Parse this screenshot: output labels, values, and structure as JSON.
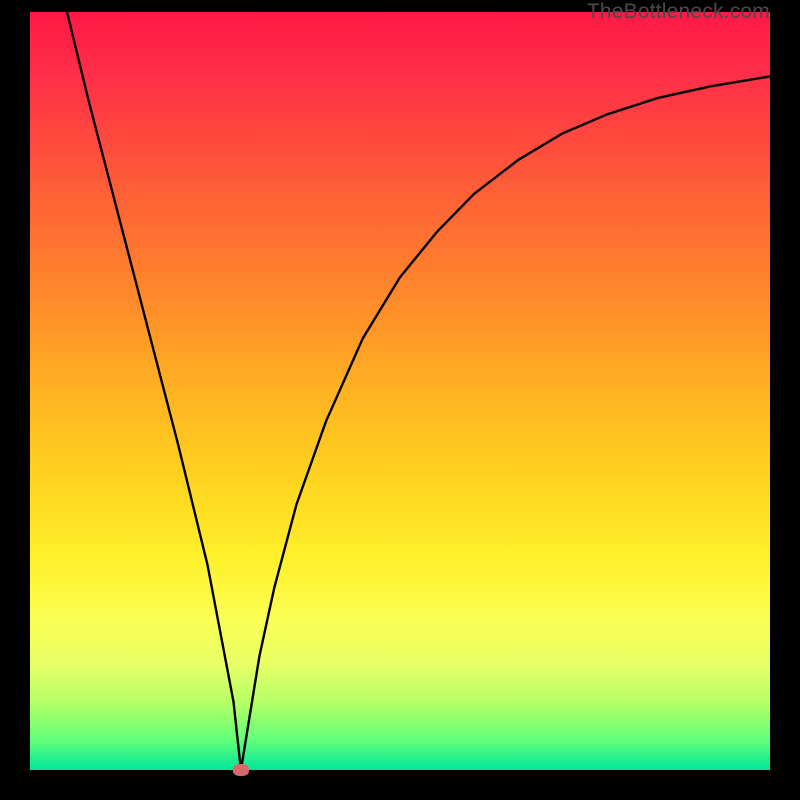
{
  "watermark": "TheBottleneck.com",
  "chart_data": {
    "type": "line",
    "title": "",
    "xlabel": "",
    "ylabel": "",
    "xlim": [
      0,
      100
    ],
    "ylim": [
      0,
      100
    ],
    "grid": false,
    "legend": null,
    "marker": {
      "x": 28.5,
      "y": 0
    },
    "series": [
      {
        "name": "curve",
        "x": [
          5,
          8,
          12,
          16,
          20,
          24,
          27.5,
          28.5,
          29.5,
          31,
          33,
          36,
          40,
          45,
          50,
          55,
          60,
          66,
          72,
          78,
          85,
          92,
          100
        ],
        "values": [
          100,
          88,
          73,
          58,
          43,
          27,
          9,
          0,
          6,
          15,
          24,
          35,
          46,
          57,
          65,
          71,
          76,
          80.5,
          84,
          86.5,
          88.7,
          90.2,
          91.5
        ]
      }
    ],
    "background": {
      "type": "vertical-gradient",
      "stops": [
        {
          "pos": 0.0,
          "color": "#ff1846"
        },
        {
          "pos": 0.22,
          "color": "#ff5a38"
        },
        {
          "pos": 0.5,
          "color": "#ffb222"
        },
        {
          "pos": 0.72,
          "color": "#fff02b"
        },
        {
          "pos": 0.86,
          "color": "#e8ff66"
        },
        {
          "pos": 1.0,
          "color": "#00e69a"
        }
      ]
    }
  }
}
